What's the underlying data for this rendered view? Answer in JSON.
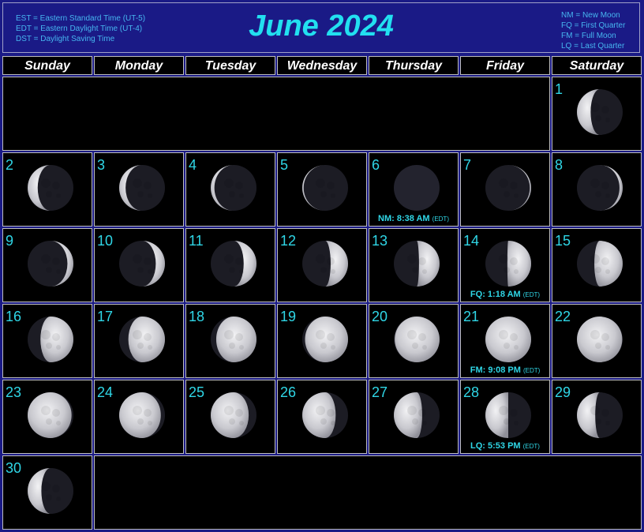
{
  "header": {
    "title": "June 2024",
    "legend_left": [
      "EST = Eastern Standard Time (UT-5)",
      "EDT = Eastern Daylight Time (UT-4)",
      "DST = Daylight Saving Time"
    ],
    "legend_right": [
      "NM = New Moon",
      "FQ = First Quarter",
      "FM = Full Moon",
      "LQ = Last Quarter"
    ]
  },
  "weekdays": [
    "Sunday",
    "Monday",
    "Tuesday",
    "Wednesday",
    "Thursday",
    "Friday",
    "Saturday"
  ],
  "first_weekday_index": 6,
  "days": [
    {
      "day": "1",
      "illum": 0.3,
      "lit": "left"
    },
    {
      "day": "2",
      "illum": 0.22,
      "lit": "left"
    },
    {
      "day": "3",
      "illum": 0.14,
      "lit": "left"
    },
    {
      "day": "4",
      "illum": 0.08,
      "lit": "left"
    },
    {
      "day": "5",
      "illum": 0.03,
      "lit": "left"
    },
    {
      "day": "6",
      "illum": 0.0,
      "lit": "none",
      "event": "NM: 8:38 AM",
      "event_tz": "(EDT)"
    },
    {
      "day": "7",
      "illum": 0.03,
      "lit": "right"
    },
    {
      "day": "8",
      "illum": 0.07,
      "lit": "right"
    },
    {
      "day": "9",
      "illum": 0.13,
      "lit": "right"
    },
    {
      "day": "10",
      "illum": 0.2,
      "lit": "right"
    },
    {
      "day": "11",
      "illum": 0.28,
      "lit": "right"
    },
    {
      "day": "12",
      "illum": 0.38,
      "lit": "right"
    },
    {
      "day": "13",
      "illum": 0.45,
      "lit": "right"
    },
    {
      "day": "14",
      "illum": 0.52,
      "lit": "right",
      "event": "FQ: 1:18 AM",
      "event_tz": "(EDT)"
    },
    {
      "day": "15",
      "illum": 0.62,
      "lit": "right"
    },
    {
      "day": "16",
      "illum": 0.72,
      "lit": "right"
    },
    {
      "day": "17",
      "illum": 0.8,
      "lit": "right"
    },
    {
      "day": "18",
      "illum": 0.88,
      "lit": "right"
    },
    {
      "day": "19",
      "illum": 0.94,
      "lit": "right"
    },
    {
      "day": "20",
      "illum": 0.98,
      "lit": "right"
    },
    {
      "day": "21",
      "illum": 1.0,
      "lit": "full",
      "event": "FM: 9:08 PM",
      "event_tz": "(EDT)"
    },
    {
      "day": "22",
      "illum": 0.99,
      "lit": "left"
    },
    {
      "day": "23",
      "illum": 0.96,
      "lit": "left"
    },
    {
      "day": "24",
      "illum": 0.91,
      "lit": "left"
    },
    {
      "day": "25",
      "illum": 0.83,
      "lit": "left"
    },
    {
      "day": "26",
      "illum": 0.73,
      "lit": "left"
    },
    {
      "day": "27",
      "illum": 0.62,
      "lit": "left"
    },
    {
      "day": "28",
      "illum": 0.5,
      "lit": "left",
      "event": "LQ: 5:53 PM",
      "event_tz": "(EDT)"
    },
    {
      "day": "29",
      "illum": 0.4,
      "lit": "left"
    },
    {
      "day": "30",
      "illum": 0.3,
      "lit": "left"
    }
  ]
}
